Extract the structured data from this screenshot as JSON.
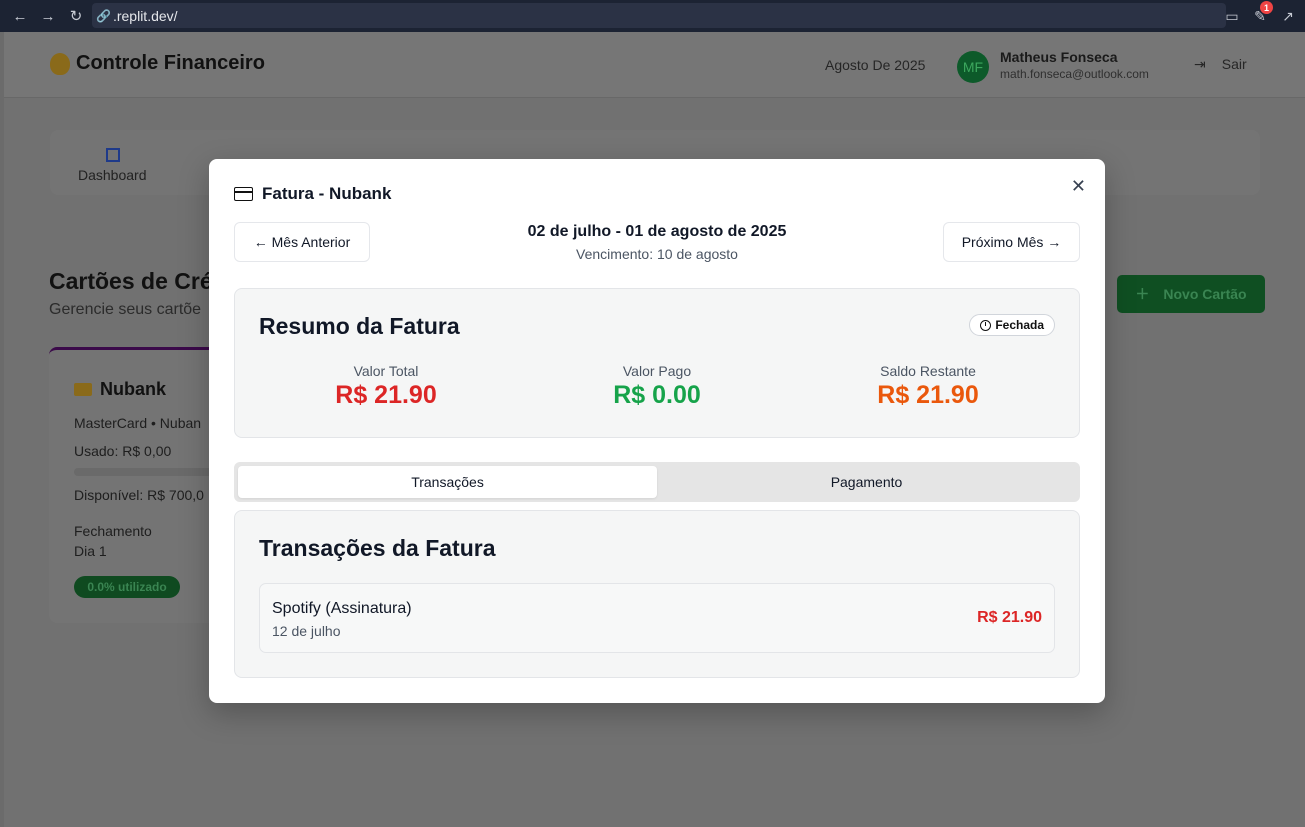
{
  "browser": {
    "url": ".replit.dev/",
    "notification_count": "1"
  },
  "app": {
    "title": "Controle Financeiro",
    "month": "Agosto De 2025",
    "user": {
      "initials": "MF",
      "name": "Matheus Fonseca",
      "email": "math.fonseca@outlook.com"
    },
    "logout_label": "Sair",
    "nav_dashboard": "Dashboard",
    "section_title": "Cartões de Cré",
    "section_subtitle": "Gerencie seus cartõe",
    "new_card_label": "Novo Cartão",
    "card": {
      "name": "Nubank",
      "brand_line": "MasterCard • Nuban",
      "used": "Usado: R$ 0,00",
      "available": "Disponível: R$ 700,0",
      "closing_label": "Fechamento",
      "closing_value": "Dia 1",
      "usage_badge": "0.0% utilizado"
    }
  },
  "modal": {
    "title": "Fatura - Nubank",
    "prev_label": "← Mês Anterior",
    "next_label": "Próximo Mês →",
    "period": "02 de julho - 01 de agosto de 2025",
    "due": "Vencimento: 10 de agosto",
    "summary": {
      "title": "Resumo da Fatura",
      "status": "Fechada",
      "total_label": "Valor Total",
      "total_value": "R$ 21.90",
      "paid_label": "Valor Pago",
      "paid_value": "R$ 0.00",
      "remaining_label": "Saldo Restante",
      "remaining_value": "R$ 21.90"
    },
    "tabs": [
      "Transações",
      "Pagamento"
    ],
    "transactions": {
      "title": "Transações da Fatura",
      "items": [
        {
          "name": "Spotify (Assinatura)",
          "date": "12 de julho",
          "amount": "R$ 21.90"
        }
      ]
    }
  },
  "colors": {
    "total": "#dc2626",
    "paid": "#16a34a",
    "remaining": "#ea580c"
  }
}
